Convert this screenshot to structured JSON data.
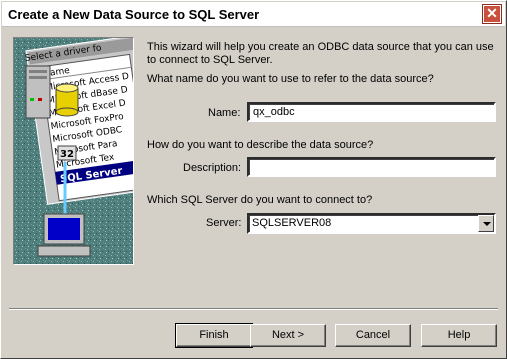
{
  "window": {
    "title": "Create a New Data Source to SQL Server",
    "close_glyph": "✕"
  },
  "illustration": {
    "header_text": "Select a driver fo",
    "column_label": "Name",
    "drivers": [
      "Microsoft Access D",
      "Microsoft dBase D",
      "Microsoft Excel D",
      "Microsoft FoxPro",
      "Microsoft ODBC",
      "Microsoft Para",
      "Microsoft Tex",
      "SQL Server"
    ],
    "badge": "32"
  },
  "intro_text": "This wizard will help you create an ODBC data source that you can use to connect to SQL Server.",
  "name_section": {
    "question": "What name do you want to use to refer to the data source?",
    "label": "Name:",
    "value": "qx_odbc"
  },
  "description_section": {
    "question": "How do you want to describe the data source?",
    "label": "Description:",
    "value": ""
  },
  "server_section": {
    "question": "Which SQL Server do you want to connect to?",
    "label": "Server:",
    "value": "SQLSERVER08"
  },
  "buttons": {
    "finish": "Finish",
    "next": "Next >",
    "cancel": "Cancel",
    "help": "Help"
  }
}
